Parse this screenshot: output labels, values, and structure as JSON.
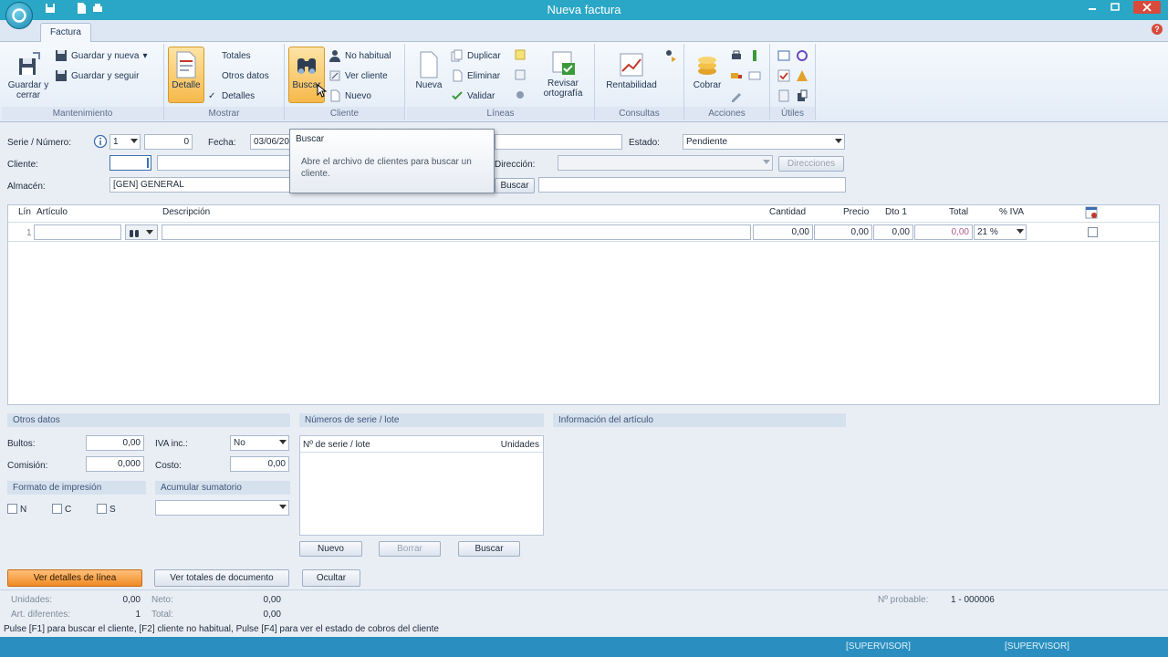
{
  "window": {
    "title": "Nueva factura"
  },
  "tabs": [
    {
      "label": "Factura"
    }
  ],
  "ribbon": {
    "mantenimiento": {
      "label": "Mantenimiento",
      "guardar_cerrar": "Guardar y cerrar",
      "guardar_nueva": "Guardar y nueva",
      "guardar_seguir": "Guardar y seguir"
    },
    "mostrar": {
      "label": "Mostrar",
      "detalle": "Detalle",
      "totales": "Totales",
      "otros_datos": "Otros datos",
      "detalles": "Detalles"
    },
    "cliente": {
      "label": "Cliente",
      "buscar": "Buscar",
      "no_habitual": "No habitual",
      "ver_cliente": "Ver cliente",
      "nuevo": "Nuevo"
    },
    "lineas": {
      "label": "Líneas",
      "nueva": "Nueva",
      "duplicar": "Duplicar",
      "eliminar": "Eliminar",
      "validar": "Validar",
      "revisar": "Revisar ortografía"
    },
    "consultas": {
      "label": "Consultas",
      "rentabilidad": "Rentabilidad"
    },
    "acciones": {
      "label": "Acciones",
      "cobrar": "Cobrar"
    },
    "utiles": {
      "label": "Útiles"
    }
  },
  "tooltip": {
    "title": "Buscar",
    "body": "Abre el archivo de clientes para buscar un cliente."
  },
  "header": {
    "serie_label": "Serie / Número:",
    "serie": "1",
    "numero": "0",
    "fecha_label": "Fecha:",
    "fecha": "03/06/20",
    "estado_label": "Estado:",
    "estado": "Pendiente",
    "cliente_label": "Cliente:",
    "direccion_label": "Dirección:",
    "direcciones_btn": "Direcciones",
    "almacen_label": "Almacén:",
    "almacen": "[GEN]  GENERAL",
    "buscar_btn": "Buscar"
  },
  "grid": {
    "columns": [
      "Lín",
      "Artículo",
      "Descripción",
      "Cantidad",
      "Precio",
      "Dto 1",
      "Total",
      "% IVA"
    ],
    "rows": [
      {
        "lin": "1",
        "articulo": "",
        "descripcion": "",
        "cantidad": "0,00",
        "precio": "0,00",
        "dto1": "0,00",
        "total": "0,00",
        "iva": "21 %"
      }
    ]
  },
  "otros_datos": {
    "title": "Otros datos",
    "bultos_label": "Bultos:",
    "bultos": "0,00",
    "iva_inc_label": "IVA inc.:",
    "iva_inc": "No",
    "comision_label": "Comisión:",
    "comision": "0,000",
    "costo_label": "Costo:",
    "costo": "0,00",
    "formato_title": "Formato de impresión",
    "formato_n": "N",
    "formato_c": "C",
    "formato_s": "S",
    "acumular_title": "Acumular sumatorio"
  },
  "serie_lote": {
    "title": "Números de serie / lote",
    "col_serie": "Nº de serie / lote",
    "col_unidades": "Unidades",
    "nuevo": "Nuevo",
    "borrar": "Borrar",
    "buscar": "Buscar"
  },
  "info_articulo": {
    "title": "Información del artículo"
  },
  "bottom_buttons": {
    "ver_detalles": "Ver detalles de línea",
    "ver_totales": "Ver totales de documento",
    "ocultar": "Ocultar"
  },
  "summary": {
    "unidades_label": "Unidades:",
    "unidades": "0,00",
    "art_label": "Art. diferentes:",
    "art": "1",
    "neto_label": "Neto:",
    "neto": "0,00",
    "total_label": "Total:",
    "total": "0,00",
    "probable_label": "Nº probable:",
    "probable": "1 - 000006"
  },
  "hint": "Pulse [F1] para buscar el cliente, [F2] cliente no habitual, Pulse [F4] para ver el estado de cobros del cliente",
  "status": {
    "user1": "[SUPERVISOR]",
    "user2": "[SUPERVISOR]"
  }
}
